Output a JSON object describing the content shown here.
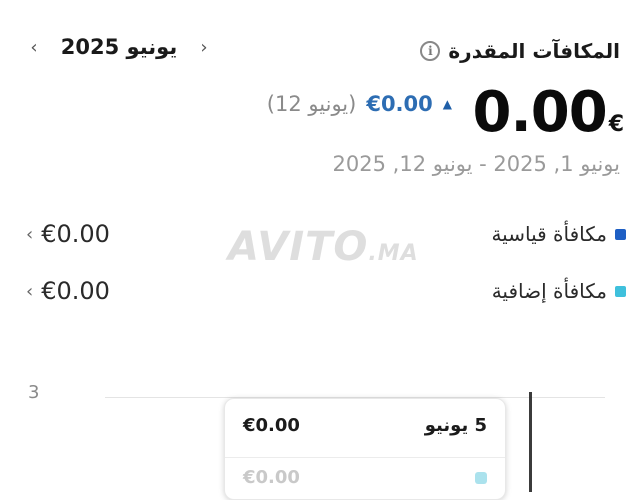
{
  "header": {
    "title": "المكافآت المقدرة",
    "info_icon": "info-icon",
    "info_glyph": "i"
  },
  "month_nav": {
    "label": "يونيو 2025",
    "prev_icon": "chevron-left-icon",
    "next_icon": "chevron-right-icon",
    "prev_glyph": "‹",
    "next_glyph": "›"
  },
  "summary": {
    "amount": "0.00",
    "currency": "€",
    "delta_icon": "triangle-up-icon",
    "delta_glyph": "▲",
    "delta_value": "€0.00",
    "delta_label": "(يونيو 12)",
    "date_range": "يونيو 1, 2025 - يونيو 12, 2025"
  },
  "legend": [
    {
      "label": "مكافأة قياسية",
      "amount": "€0.00",
      "color": "#1e5fc4"
    },
    {
      "label": "مكافأة إضافية",
      "amount": "€0.00",
      "color": "#3fc0dc"
    }
  ],
  "legend_chevron_glyph": "‹",
  "watermark": {
    "main": "AVITO",
    "suffix": ".MA"
  },
  "chart": {
    "y_tick": "3"
  },
  "tooltip": {
    "rows": [
      {
        "date": "5 يونيو",
        "amount": "€0.00"
      },
      {
        "date": "",
        "amount": "€0.00"
      }
    ]
  },
  "colors": {
    "accent": "#2d6db3",
    "standard": "#1e5fc4",
    "extra": "#3fc0dc"
  }
}
